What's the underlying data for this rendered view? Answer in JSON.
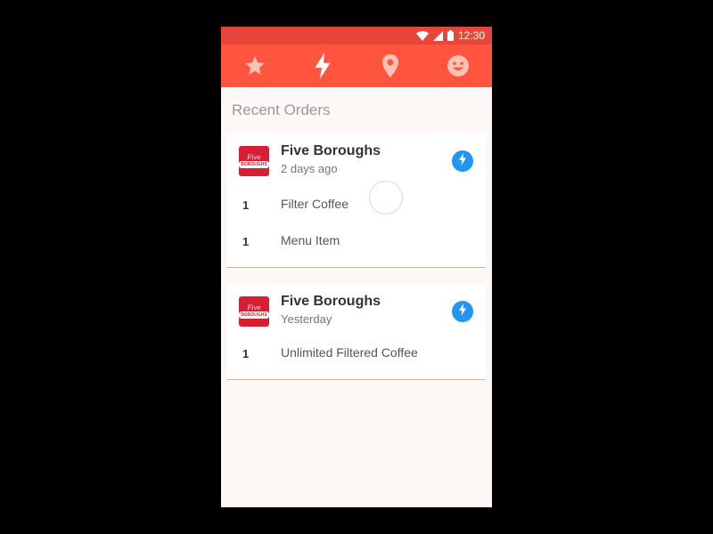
{
  "status_bar": {
    "time": "12:30",
    "icons": [
      "wifi-icon",
      "signal-icon",
      "battery-icon"
    ],
    "color": "#e9463b"
  },
  "toolbar": {
    "color": "#ff553f",
    "tabs": [
      {
        "icon": "star-icon",
        "active": false
      },
      {
        "icon": "lightning-bolt-icon",
        "active": true
      },
      {
        "icon": "location-pin-icon",
        "active": false
      },
      {
        "icon": "smiley-face-icon",
        "active": false
      }
    ]
  },
  "main": {
    "section_title": "Recent Orders",
    "orders": [
      {
        "merchant": "Five Boroughs",
        "when": "2 days ago",
        "logo_text": [
          "Five",
          "BOROUGHS"
        ],
        "badge_icon": "lightning-bolt-icon",
        "items": [
          {
            "qty": "1",
            "name": "Filter Coffee"
          },
          {
            "qty": "1",
            "name": "Menu Item"
          }
        ]
      },
      {
        "merchant": "Five Boroughs",
        "when": "Yesterday",
        "logo_text": [
          "Five",
          "BOROUGHS"
        ],
        "badge_icon": "lightning-bolt-icon",
        "items": [
          {
            "qty": "1",
            "name": "Unlimited Filtered Coffee"
          }
        ]
      }
    ]
  },
  "colors": {
    "badge": "#2196f3",
    "logo": "#d71f34",
    "background": "#fdf8f6"
  }
}
